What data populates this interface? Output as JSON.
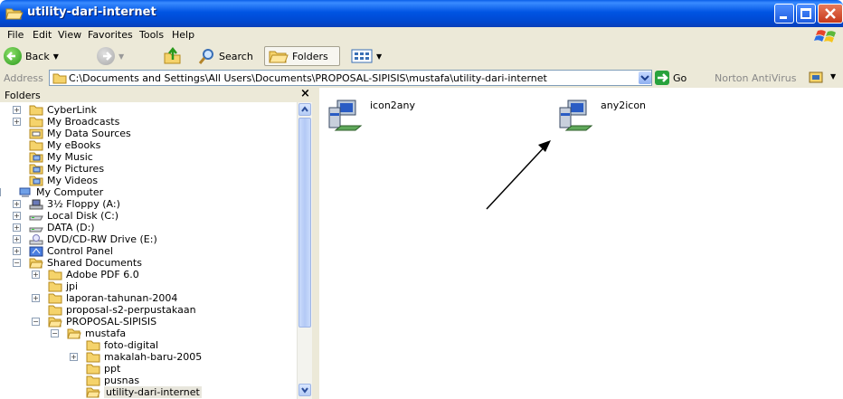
{
  "window": {
    "title": "utility-dari-internet"
  },
  "menu": {
    "items": [
      "File",
      "Edit",
      "View",
      "Favorites",
      "Tools",
      "Help"
    ]
  },
  "toolbar": {
    "back_label": "Back",
    "search_label": "Search",
    "folders_label": "Folders"
  },
  "address": {
    "label": "Address",
    "value": "C:\\Documents and Settings\\All Users\\Documents\\PROPOSAL-SIPISIS\\mustafa\\utility-dari-internet",
    "go_label": "Go",
    "norton_label": "Norton AntiVirus"
  },
  "folders_pane": {
    "title": "Folders",
    "close_glyph": "×",
    "tree": [
      {
        "label": "CyberLink",
        "indent": 1,
        "expander": "+",
        "icon": "folder-icon"
      },
      {
        "label": "My Broadcasts",
        "indent": 1,
        "expander": "+",
        "icon": "folder-icon"
      },
      {
        "label": "My Data Sources",
        "indent": 1,
        "expander": "",
        "icon": "data-sources-icon"
      },
      {
        "label": "My eBooks",
        "indent": 1,
        "expander": "",
        "icon": "folder-icon"
      },
      {
        "label": "My Music",
        "indent": 1,
        "expander": "",
        "icon": "music-folder-icon"
      },
      {
        "label": "My Pictures",
        "indent": 1,
        "expander": "",
        "icon": "pictures-folder-icon"
      },
      {
        "label": "My Videos",
        "indent": 1,
        "expander": "",
        "icon": "videos-folder-icon"
      },
      {
        "label": "My Computer",
        "indent": 0,
        "expander": "-",
        "icon": "my-computer-icon"
      },
      {
        "label": "3½ Floppy (A:)",
        "indent": 1,
        "expander": "+",
        "icon": "floppy-drive-icon"
      },
      {
        "label": "Local Disk (C:)",
        "indent": 1,
        "expander": "+",
        "icon": "hard-disk-icon"
      },
      {
        "label": "DATA (D:)",
        "indent": 1,
        "expander": "+",
        "icon": "hard-disk-icon"
      },
      {
        "label": "DVD/CD-RW Drive (E:)",
        "indent": 1,
        "expander": "+",
        "icon": "dvd-drive-icon"
      },
      {
        "label": "Control Panel",
        "indent": 1,
        "expander": "+",
        "icon": "control-panel-icon"
      },
      {
        "label": "Shared Documents",
        "indent": 1,
        "expander": "-",
        "icon": "open-folder-icon"
      },
      {
        "label": "Adobe PDF 6.0",
        "indent": 2,
        "expander": "+",
        "icon": "folder-icon"
      },
      {
        "label": "jpi",
        "indent": 2,
        "expander": "",
        "icon": "folder-icon"
      },
      {
        "label": "laporan-tahunan-2004",
        "indent": 2,
        "expander": "+",
        "icon": "folder-icon"
      },
      {
        "label": "proposal-s2-perpustakaan",
        "indent": 2,
        "expander": "",
        "icon": "folder-icon"
      },
      {
        "label": "PROPOSAL-SIPISIS",
        "indent": 2,
        "expander": "-",
        "icon": "open-folder-icon"
      },
      {
        "label": "mustafa",
        "indent": 3,
        "expander": "-",
        "icon": "open-folder-icon"
      },
      {
        "label": "foto-digital",
        "indent": 4,
        "expander": "",
        "icon": "folder-icon"
      },
      {
        "label": "makalah-baru-2005",
        "indent": 4,
        "expander": "+",
        "icon": "folder-icon"
      },
      {
        "label": "ppt",
        "indent": 4,
        "expander": "",
        "icon": "folder-icon"
      },
      {
        "label": "pusnas",
        "indent": 4,
        "expander": "",
        "icon": "folder-icon"
      },
      {
        "label": "utility-dari-internet",
        "indent": 4,
        "expander": "",
        "icon": "open-folder-icon",
        "selected": true
      }
    ]
  },
  "files": [
    {
      "name": "icon2any",
      "icon": "installer-icon"
    },
    {
      "name": "any2icon",
      "icon": "installer-icon"
    }
  ],
  "colors": {
    "title_blue": "#0054e3",
    "chrome": "#ece9d8",
    "folder_yellow": "#f5d36b",
    "selection": "#e8e6dc"
  }
}
